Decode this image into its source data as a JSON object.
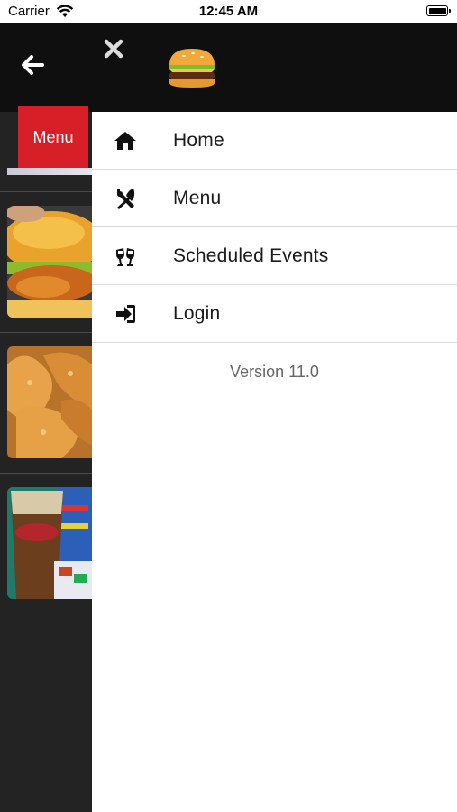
{
  "status_bar": {
    "carrier": "Carrier",
    "time": "12:45 AM"
  },
  "background": {
    "menu_tab_label": "Menu",
    "food_items": [
      "burger-photo",
      "chicken-tenders-photo",
      "drink-cup-photo"
    ]
  },
  "drawer": {
    "items": [
      {
        "label": "Home",
        "icon": "home-icon"
      },
      {
        "label": "Menu",
        "icon": "utensils-icon"
      },
      {
        "label": "Scheduled Events",
        "icon": "cheers-icon"
      },
      {
        "label": "Login",
        "icon": "sign-in-icon"
      }
    ],
    "version": "Version 11.0"
  },
  "colors": {
    "header_bg": "#0f0f0f",
    "accent_red": "#d71f27",
    "drawer_bg": "#ffffff",
    "page_bg": "#232323"
  }
}
